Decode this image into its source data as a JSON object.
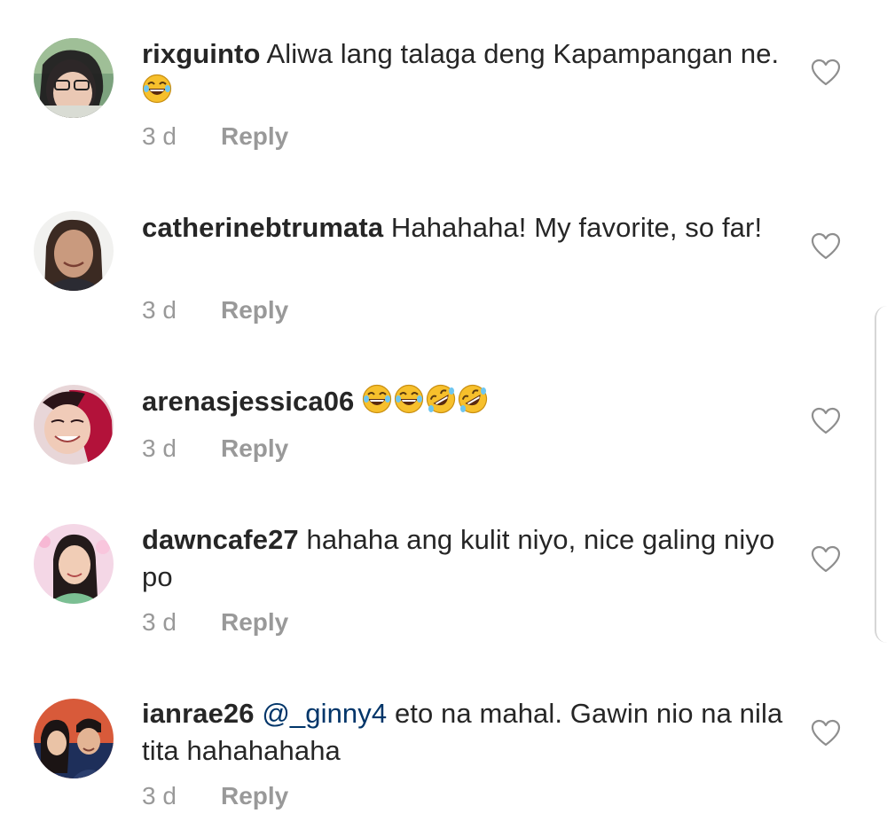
{
  "comments": [
    {
      "username": "rixguinto",
      "mention": "",
      "text": "Aliwa lang talaga deng Kapampangan ne.",
      "emoji": [
        "laughing"
      ],
      "time": "3 d",
      "reply": "Reply"
    },
    {
      "username": "catherinebtrumata",
      "mention": "",
      "text": "Hahahaha! My favorite, so far!",
      "emoji": [],
      "time": "3 d",
      "reply": "Reply"
    },
    {
      "username": "arenasjessica06",
      "mention": "",
      "text": "",
      "emoji": [
        "laughing",
        "laughing",
        "rolling-on-floor-laughing",
        "rolling-on-floor-laughing"
      ],
      "time": "3 d",
      "reply": "Reply"
    },
    {
      "username": "dawncafe27",
      "mention": "",
      "text": "hahaha ang kulit niyo, nice galing niyo po",
      "emoji": [],
      "time": "3 d",
      "reply": "Reply"
    },
    {
      "username": "ianrae26",
      "mention": "@_ginny4",
      "text": "eto na mahal. Gawin nio na nila tita hahahahaha",
      "emoji": [],
      "time": "3 d",
      "reply": "Reply"
    }
  ],
  "colors": {
    "text": "#262626",
    "meta": "#999999",
    "mention": "#003569",
    "emoji": "#f7c02c"
  },
  "icons": {
    "like": "heart-outline-icon",
    "laughing": "face-with-tears-of-joy-emoji",
    "rolling-on-floor-laughing": "rolling-on-the-floor-laughing-emoji"
  }
}
